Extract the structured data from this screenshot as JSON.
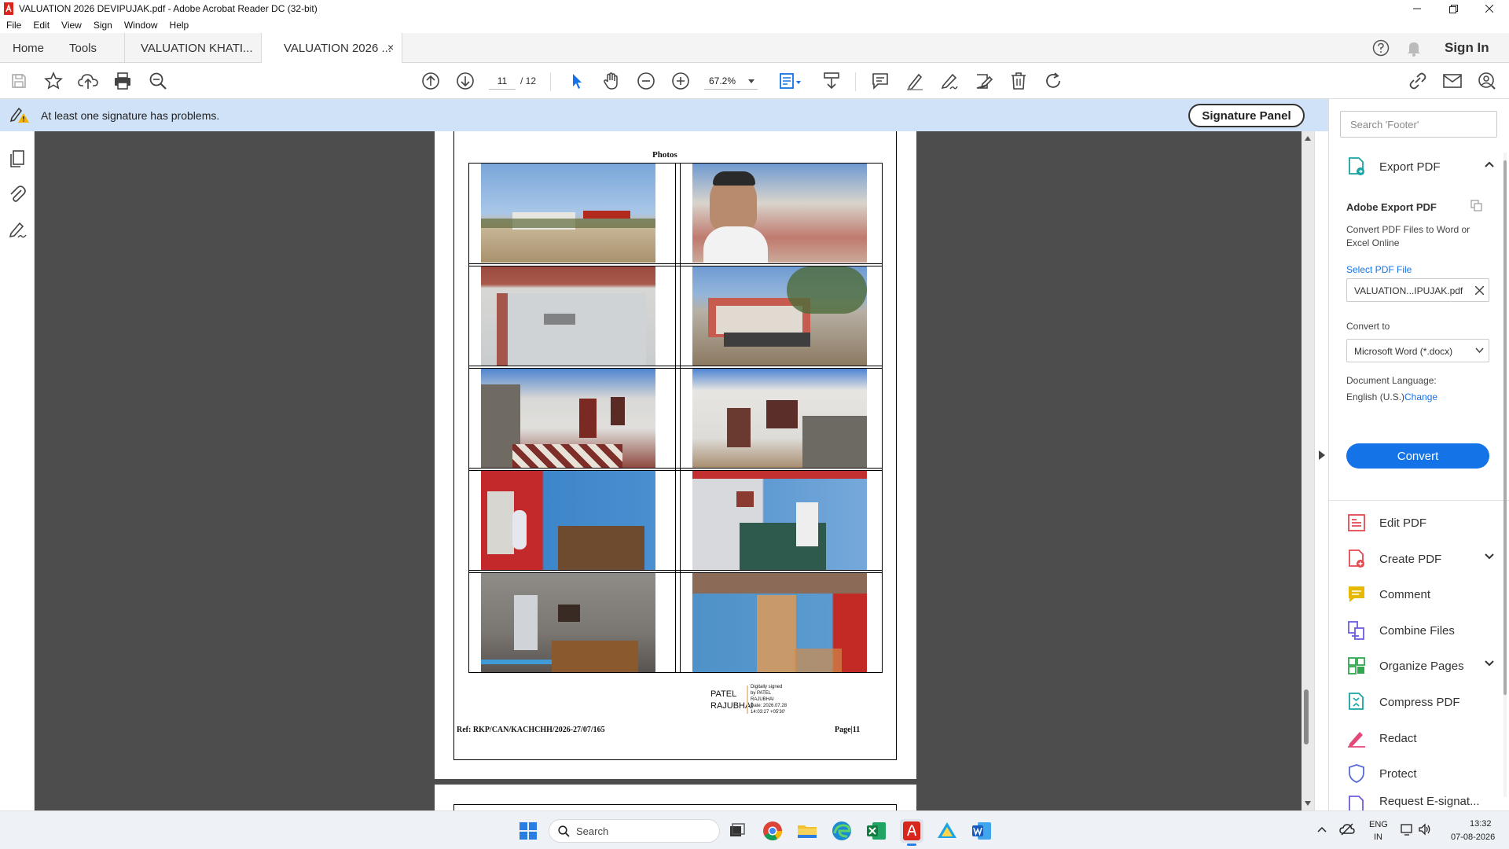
{
  "window": {
    "title": "VALUATION 2026 DEVIPUJAK.pdf - Adobe Acrobat Reader DC (32-bit)"
  },
  "menu": [
    "File",
    "Edit",
    "View",
    "Sign",
    "Window",
    "Help"
  ],
  "tabs": {
    "home": "Home",
    "tools": "Tools",
    "doc1": "VALUATION KHATI...",
    "doc2": "VALUATION 2026 ...",
    "close": "×",
    "sign_in": "Sign In"
  },
  "toolbar": {
    "page_current": "11",
    "page_total": "/ 12",
    "zoom": "67.2%"
  },
  "signature_bar": {
    "message": "At least one signature has problems.",
    "button": "Signature Panel"
  },
  "document": {
    "heading": "Photos",
    "signer_name": "PATEL\nRAJUBHAI",
    "signature_details": "Digitally signed\nby PATEL\nRAJUBHAI\nDate: 2026.07.28\n14:03:27 +05'30'",
    "footer_ref": "Ref: RKP/CAN/KACHCHH/2026-27/07/165",
    "footer_page": "Page|11"
  },
  "right_pane": {
    "search_placeholder": "Search 'Footer'",
    "export_title": "Export PDF",
    "adobe_export_title": "Adobe Export PDF",
    "adobe_export_desc": "Convert PDF Files to Word or Excel Online",
    "select_file_label": "Select PDF File",
    "selected_file": "VALUATION...IPUJAK.pdf",
    "convert_to_label": "Convert to",
    "convert_to_value": "Microsoft Word (*.docx)",
    "doc_language_label": "Document Language:",
    "doc_language_value": "English (U.S.)",
    "change_link": "Change",
    "convert_button": "Convert",
    "tools": [
      {
        "label": "Edit PDF",
        "icon": "edit-pdf-icon",
        "color": "#e34850"
      },
      {
        "label": "Create PDF",
        "icon": "create-pdf-icon",
        "color": "#e34850"
      },
      {
        "label": "Comment",
        "icon": "comment-icon",
        "color": "#e6b800"
      },
      {
        "label": "Combine Files",
        "icon": "combine-files-icon",
        "color": "#6b5de0"
      },
      {
        "label": "Organize Pages",
        "icon": "organize-pages-icon",
        "color": "#2fa84f"
      },
      {
        "label": "Compress PDF",
        "icon": "compress-pdf-icon",
        "color": "#1aa3a3"
      },
      {
        "label": "Redact",
        "icon": "redact-icon",
        "color": "#e34877"
      },
      {
        "label": "Protect",
        "icon": "protect-icon",
        "color": "#5a6ad4"
      },
      {
        "label": "Request E-signat...",
        "icon": "request-esign-icon",
        "color": "#6b5de0"
      }
    ]
  },
  "taskbar": {
    "search_placeholder": "Search",
    "language": "ENG",
    "region": "IN",
    "time": "13:32",
    "date": "07-08-2026"
  },
  "colors": {
    "accent": "#1473e6",
    "banner": "#cfe2f7",
    "doc_bg": "#4d4d4d"
  }
}
